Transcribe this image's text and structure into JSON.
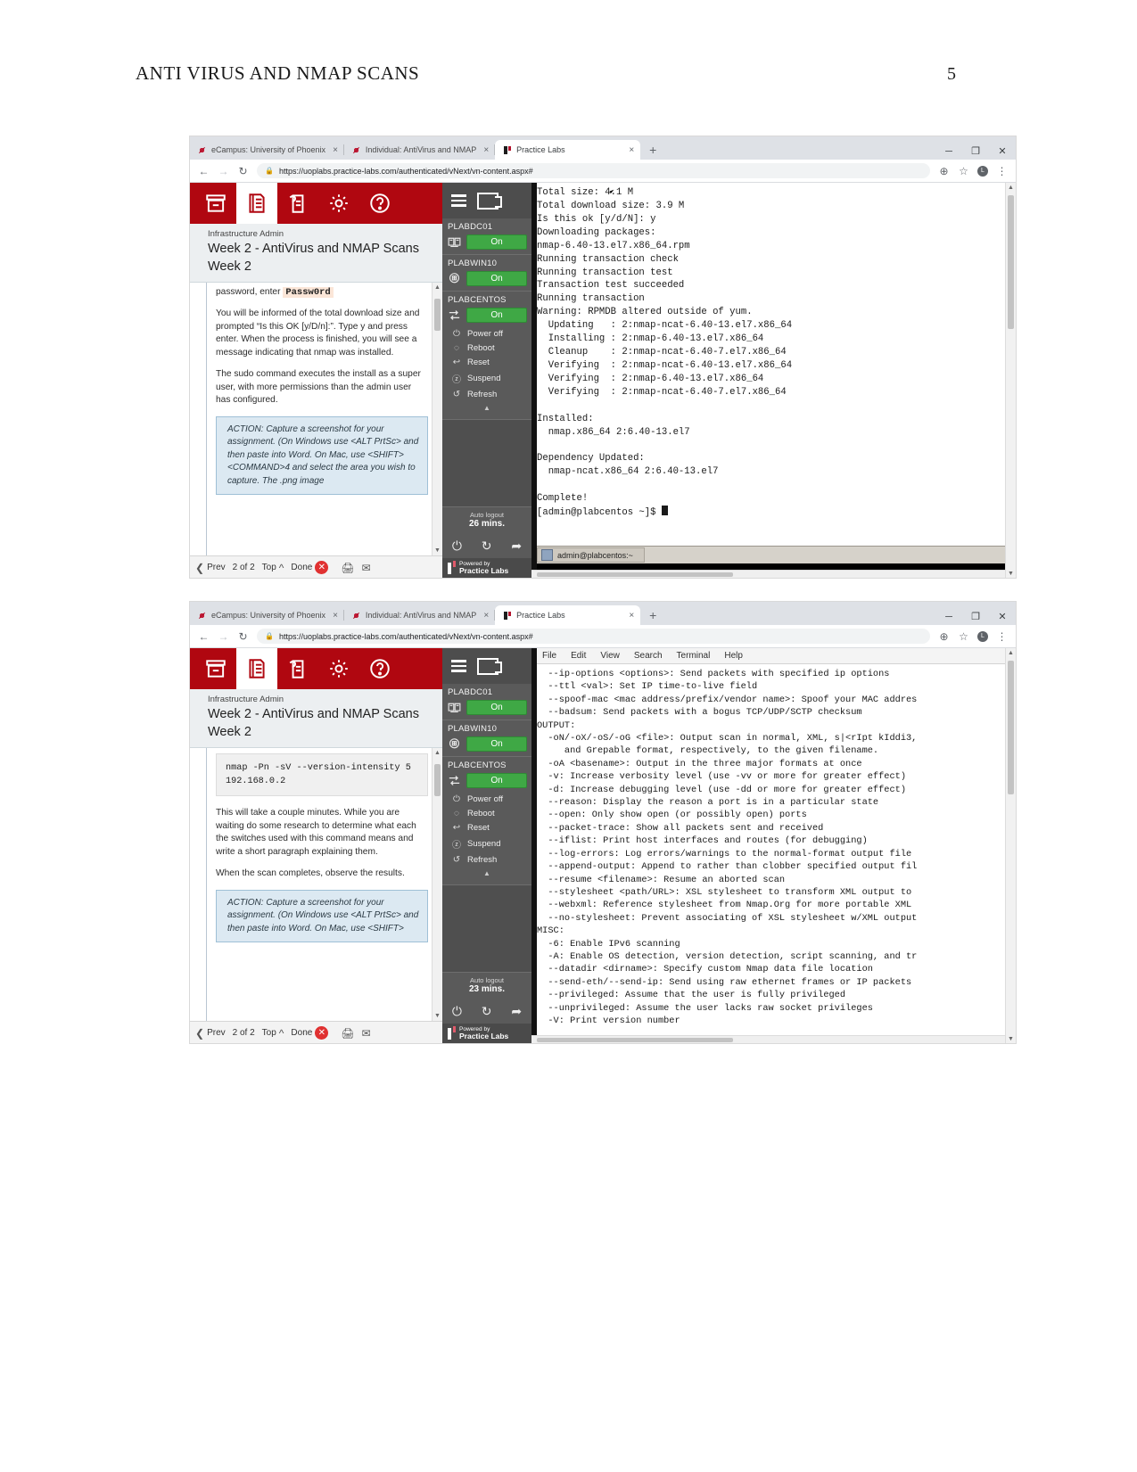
{
  "document": {
    "header_title": "ANTI VIRUS AND NMAP SCANS",
    "page_number": "5"
  },
  "browser": {
    "tabs": [
      {
        "label": "eCampus: University of Phoenix",
        "favicon": "uop-icon",
        "active": false,
        "close": "×"
      },
      {
        "label": "Individual: AntiVirus and NMAP",
        "favicon": "uop-icon",
        "active": false,
        "close": "×"
      },
      {
        "label": "Practice Labs",
        "favicon": "practice-labs-icon",
        "active": true,
        "close": "×"
      }
    ],
    "new_tab": "+",
    "window_controls": {
      "minimize": "─",
      "maximize": "❐",
      "close": "✕"
    },
    "nav": {
      "back": "←",
      "forward": "→",
      "reload": "↻",
      "lock": "ὑ2"
    },
    "url": "https://uoplabs.practice-labs.com/authenticated/vNext/vn-content.aspx#",
    "omni_right": {
      "zoom": "⊕",
      "star": "☆",
      "profile": "L",
      "menu": "⋮"
    }
  },
  "lab": {
    "toolbar_icons": [
      "archive-icon",
      "document-icon",
      "notes-icon",
      "settings-gear-icon",
      "help-icon"
    ],
    "subtitle": "Infrastructure Admin",
    "title": "Week 2 - AntiVirus and NMAP Scans",
    "week": "Week 2",
    "footer": {
      "prev": "Prev",
      "page_indicator": "2 of 2",
      "top": "Top",
      "done": "Done",
      "close": "✕",
      "print_icon": "printer-icon",
      "support_icon": "support-icon",
      "brand_small": "Powered by",
      "brand": "Practice Labs"
    }
  },
  "shot1": {
    "lab_content": {
      "line_password": "password, enter ",
      "code_password": "Passw0rd",
      "para1": "You will be informed of the total download size and prompted “Is this OK [y/D/n]:”. Type y and press enter. When the process is finished, you will see a message indicating that nmap was installed.",
      "para2": "The sudo command executes the install as a super user, with more permissions than the admin user has configured.",
      "action": "ACTION: Capture a screenshot for your assignment. (On Windows use <ALT PrtSc> and then paste into Word. On Mac, use <SHIFT><COMMAND>4 and select the area you wish to capture. The .png image"
    },
    "auto_logout_label": "Auto logout",
    "auto_logout_value": "26 mins.",
    "terminal_text": "Total size: 4.1 M\nTotal download size: 3.9 M\nIs this ok [y/d/N]: y\nDownloading packages:\nnmap-6.40-13.el7.x86_64.rpm\nRunning transaction check\nRunning transaction test\nTransaction test succeeded\nRunning transaction\nWarning: RPMDB altered outside of yum.\n  Updating   : 2:nmap-ncat-6.40-13.el7.x86_64\n  Installing : 2:nmap-6.40-13.el7.x86_64\n  Cleanup    : 2:nmap-ncat-6.40-7.el7.x86_64\n  Verifying  : 2:nmap-ncat-6.40-13.el7.x86_64\n  Verifying  : 2:nmap-6.40-13.el7.x86_64\n  Verifying  : 2:nmap-ncat-6.40-7.el7.x86_64\n\nInstalled:\n  nmap.x86_64 2:6.40-13.el7\n\nDependency Updated:\n  nmap-ncat.x86_64 2:6.40-13.el7\n\nComplete!\n[admin@plabcentos ~]$ ",
    "taskbar_button": "admin@plabcentos:~"
  },
  "shot2": {
    "lab_content": {
      "code_block": "nmap -Pn -sV --version-intensity 5 192.168.0.2",
      "para1": "This will take a couple minutes. While you are waiting do some research to determine what each the switches used with this command means and write a short paragraph explaining them.",
      "para2": "When the scan completes, observe the results.",
      "action": "ACTION: Capture a screenshot for your assignment. (On Windows use <ALT PrtSc> and then paste into Word. On Mac, use <SHIFT>"
    },
    "auto_logout_label": "Auto logout",
    "auto_logout_value": "23 mins.",
    "terminal_menu": [
      "File",
      "Edit",
      "View",
      "Search",
      "Terminal",
      "Help"
    ],
    "terminal_text": "  --ip-options <options>: Send packets with specified ip options\n  --ttl <val>: Set IP time-to-live field\n  --spoof-mac <mac address/prefix/vendor name>: Spoof your MAC addres\n  --badsum: Send packets with a bogus TCP/UDP/SCTP checksum\nOUTPUT:\n  -oN/-oX/-oS/-oG <file>: Output scan in normal, XML, s|<rIpt kIddi3,\n     and Grepable format, respectively, to the given filename.\n  -oA <basename>: Output in the three major formats at once\n  -v: Increase verbosity level (use -vv or more for greater effect)\n  -d: Increase debugging level (use -dd or more for greater effect)\n  --reason: Display the reason a port is in a particular state\n  --open: Only show open (or possibly open) ports\n  --packet-trace: Show all packets sent and received\n  --iflist: Print host interfaces and routes (for debugging)\n  --log-errors: Log errors/warnings to the normal-format output file\n  --append-output: Append to rather than clobber specified output fil\n  --resume <filename>: Resume an aborted scan\n  --stylesheet <path/URL>: XSL stylesheet to transform XML output to \n  --webxml: Reference stylesheet from Nmap.Org for more portable XML \n  --no-stylesheet: Prevent associating of XSL stylesheet w/XML output\nMISC:\n  -6: Enable IPv6 scanning\n  -A: Enable OS detection, version detection, script scanning, and tr\n  --datadir <dirname>: Specify custom Nmap data file location\n  --send-eth/--send-ip: Send using raw ethernet frames or IP packets\n  --privileged: Assume that the user is fully privileged\n  --unprivileged: Assume the user lacks raw socket privileges\n  -V: Print version number"
  },
  "vmrail": {
    "menu_icon": "hamburger-icon",
    "screen_icon": "screens-icon",
    "devices": [
      {
        "name": "PLABDC01",
        "icon": "server-icon",
        "state": "On"
      },
      {
        "name": "PLABWIN10",
        "icon": "windows-icon",
        "state": "On"
      },
      {
        "name": "PLABCENTOS",
        "icon": "network-icon",
        "state": "On"
      }
    ],
    "actions": [
      {
        "label": "Power off",
        "icon": "power-icon"
      },
      {
        "label": "Reboot",
        "icon": "reboot-icon"
      },
      {
        "label": "Reset",
        "icon": "reset-icon"
      },
      {
        "label": "Suspend",
        "icon": "suspend-icon"
      },
      {
        "label": "Refresh",
        "icon": "refresh-icon"
      }
    ],
    "collapse": "▲",
    "bottom_icons": [
      "power-icon",
      "refresh-icon",
      "exit-icon"
    ],
    "brand_small": "Powered by",
    "brand": "Practice Labs"
  }
}
